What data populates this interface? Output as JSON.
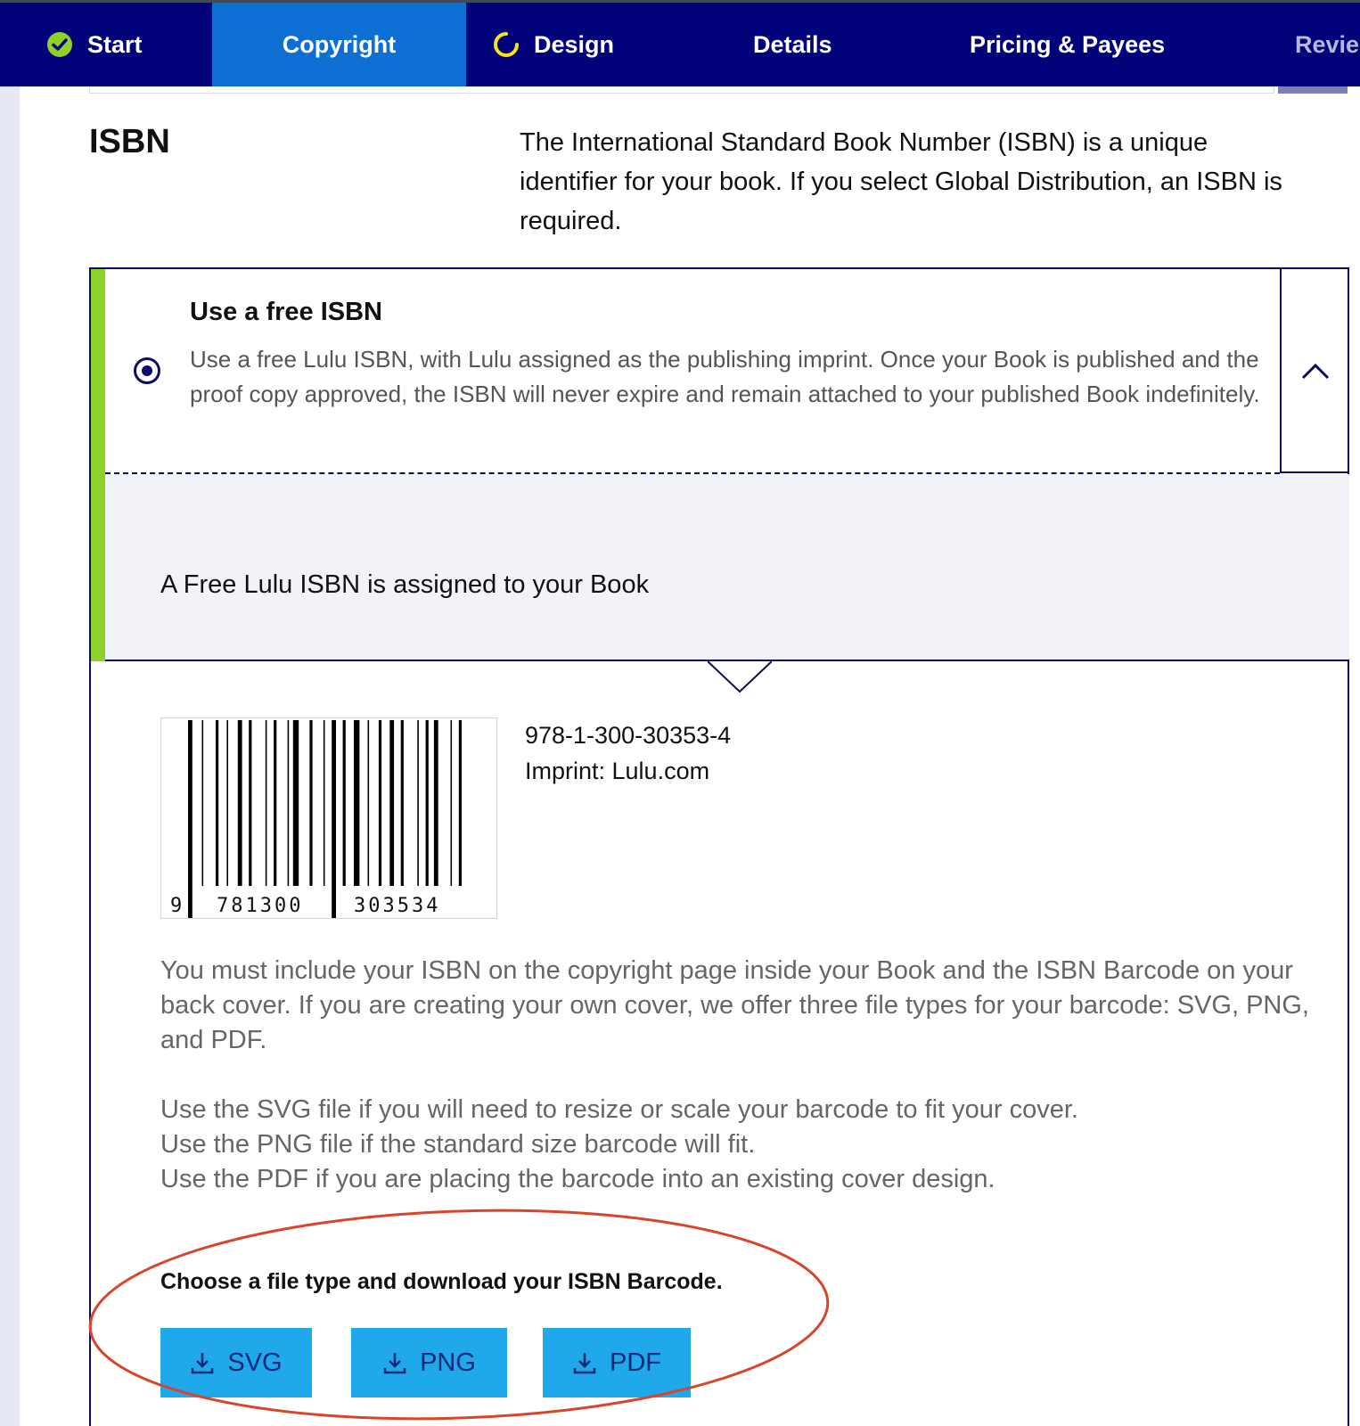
{
  "nav": {
    "items": [
      {
        "label": "Start",
        "state": "complete"
      },
      {
        "label": "Copyright",
        "state": "active"
      },
      {
        "label": "Design",
        "state": "in-progress"
      },
      {
        "label": "Details",
        "state": "default"
      },
      {
        "label": "Pricing & Payees",
        "state": "default"
      },
      {
        "label": "Revie",
        "state": "disabled"
      }
    ]
  },
  "isbn_section": {
    "title": "ISBN",
    "intro": "The International Standard Book Number (ISBN) is a unique identifier for your book. If you select Global Distribution, an ISBN is required."
  },
  "option": {
    "title": "Use a free ISBN",
    "description": "Use a free Lulu ISBN, with Lulu assigned as the publishing imprint. Once your Book is published and the proof copy approved, the ISBN will never expire and remain attached to your published Book indefinitely.",
    "selected": true,
    "assigned_message": "A Free Lulu ISBN is assigned to your Book"
  },
  "barcode": {
    "lead_digit": "9",
    "left_group": "781300",
    "right_group": "303534",
    "isbn": "978-1-300-30353-4",
    "imprint": "Imprint: Lulu.com"
  },
  "instructions": {
    "para1": "You must include your ISBN on the copyright page inside your Book and the ISBN Barcode on your back cover. If you are creating your own cover, we offer three file types for your barcode: SVG, PNG, and PDF.",
    "svg_line": "Use the SVG file if you will need to resize or scale your barcode to fit your cover.",
    "png_line": "Use the PNG file if the standard size barcode will fit.",
    "pdf_line": "Use the PDF if you are placing the barcode into an existing cover design.",
    "choose": "Choose a file type and download your ISBN Barcode."
  },
  "downloads": {
    "svg": "SVG",
    "png": "PNG",
    "pdf": "PDF"
  },
  "colors": {
    "nav_bg": "#02027a",
    "nav_active": "#0d6fd3",
    "accent_green": "#8fd12b",
    "button_bg": "#1fa8ea",
    "annotation_red": "#d9452b"
  },
  "icons": [
    "check-circle-icon",
    "spinner-icon",
    "chevron-up-icon",
    "download-icon"
  ]
}
